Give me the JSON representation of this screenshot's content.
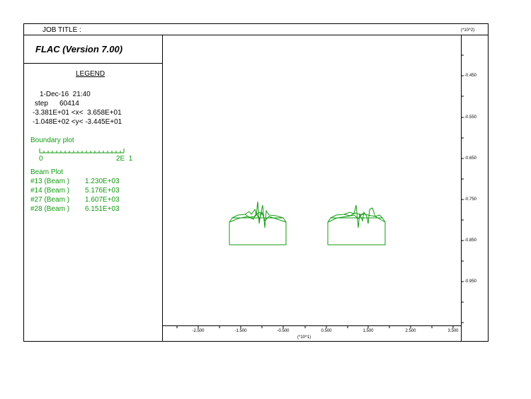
{
  "header": {
    "job_title_label": "JOB TITLE :",
    "app_title": "FLAC (Version 7.00)"
  },
  "legend": {
    "title": "LEGEND",
    "date_time": "1-Dec-16  21:40",
    "step_label": "step",
    "step_value": "60414",
    "x_range": "-3.381E+01 <x<  3.658E+01",
    "y_range": "-1.048E+02 <y< -3.445E+01",
    "boundary_label": "Boundary plot",
    "scale_min": "0",
    "scale_max": "2E  1",
    "beam_plot_label": "Beam Plot",
    "beams": [
      {
        "name": "#13 (Beam )",
        "value": "1.230E+03"
      },
      {
        "name": "#14 (Beam )",
        "value": "5.176E+03"
      },
      {
        "name": "#27 (Beam )",
        "value": "1.607E+03"
      },
      {
        "name": "#28 (Beam )",
        "value": "6.151E+03"
      }
    ]
  },
  "plot": {
    "y_scale_label": "(*10^2)",
    "y_ticks": [
      "-0.450",
      "-0.550",
      "-0.650",
      "-0.750",
      "-0.850",
      "-0.950"
    ],
    "x_ticks": [
      "-2.500",
      "-1.500",
      "-0.500",
      "0.500",
      "1.500",
      "2.500",
      "3.500"
    ],
    "x_scale_label": "(*10^1)"
  },
  "colors": {
    "plot_line": "#129b12",
    "text_green": "#129b12"
  }
}
